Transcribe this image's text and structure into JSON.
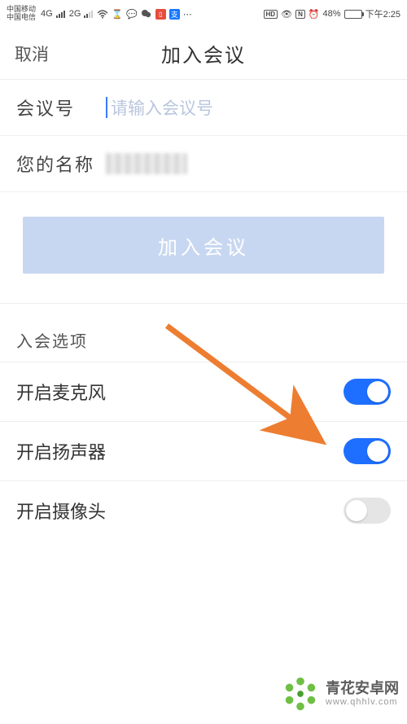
{
  "status": {
    "carrier1": "中国移动",
    "carrier2": "中国电信",
    "net": "4G",
    "net2": "2G",
    "battery_pct": "48%",
    "time": "下午2:25"
  },
  "nav": {
    "cancel": "取消",
    "title": "加入会议"
  },
  "form": {
    "meeting_id_label": "会议号",
    "meeting_id_placeholder": "请输入会议号",
    "name_label": "您的名称"
  },
  "actions": {
    "join_label": "加入会议"
  },
  "options": {
    "header": "入会选项",
    "items": [
      {
        "label": "开启麦克风",
        "on": true
      },
      {
        "label": "开启扬声器",
        "on": true
      },
      {
        "label": "开启摄像头",
        "on": false
      }
    ]
  },
  "watermark": {
    "main": "青花安卓网",
    "sub": "www.qhhlv.com"
  }
}
